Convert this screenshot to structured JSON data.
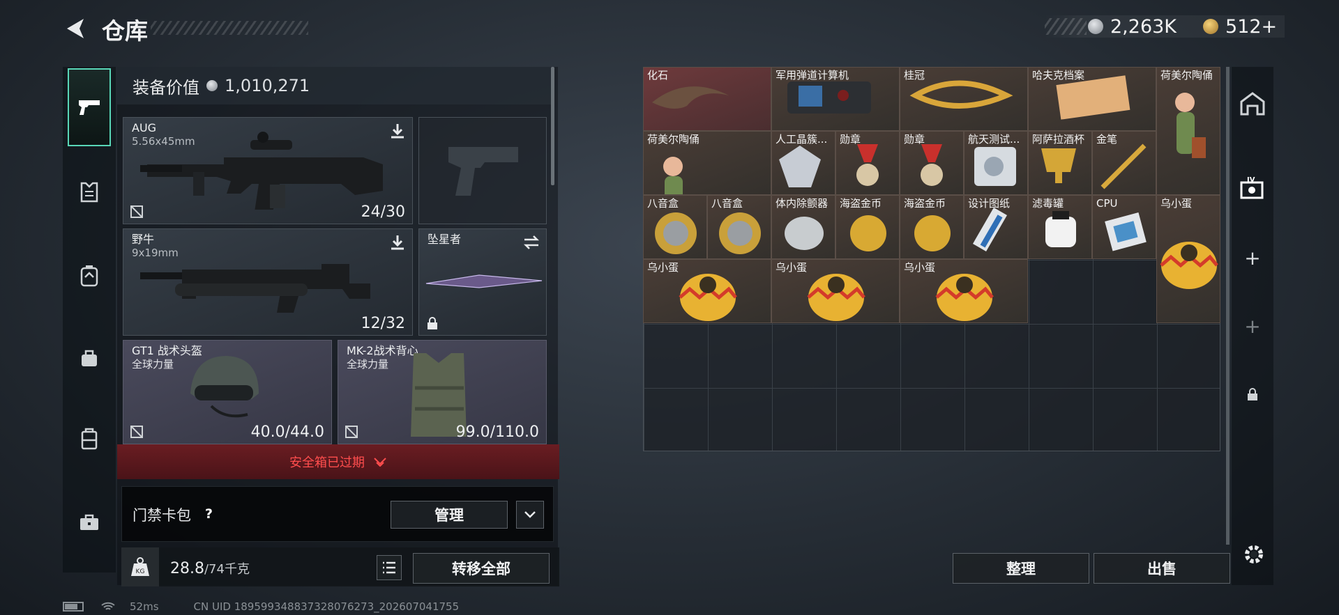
{
  "header": {
    "title": "仓库",
    "silver": "2,263K",
    "gold": "512+"
  },
  "equip_value": {
    "label": "装备价值",
    "value": "1,010,271"
  },
  "slots": {
    "primary": {
      "name": "AUG",
      "caliber": "5.56x45mm",
      "ammo": "24/30"
    },
    "secondary": {
      "name": "野牛",
      "caliber": "9x19mm",
      "ammo": "12/32"
    },
    "melee": {
      "name": "坠星者"
    },
    "helmet": {
      "name": "GT1 战术头盔",
      "brand": "全球力量",
      "durability": "40.0/44.0"
    },
    "vest": {
      "name": "MK-2战术背心",
      "brand": "全球力量",
      "durability": "99.0/110.0"
    }
  },
  "safebox": {
    "expired": "安全箱已过期"
  },
  "keycard": {
    "label": "门禁卡包",
    "help": "?",
    "manage": "管理"
  },
  "weight": {
    "current": "28.8",
    "max": "/74千克",
    "transfer_all": "转移全部"
  },
  "inventory": {
    "items": [
      "化石",
      "军用弹道计算机",
      "桂冠",
      "哈夫克档案",
      "荷美尔陶俑",
      "荷美尔陶俑",
      "人工晶簇...",
      "勋章",
      "勋章",
      "航天测试...",
      "阿萨拉酒杯",
      "金笔",
      "八音盒",
      "八音盒",
      "体内除颤器",
      "海盗金币",
      "海盗金币",
      "设计图纸",
      "滤毒罐",
      "CPU",
      "乌小蛋",
      "乌小蛋",
      "乌小蛋",
      "乌小蛋"
    ],
    "sort": "整理",
    "sell": "出售"
  },
  "status": {
    "ping": "52ms",
    "uid": "CN UID 1895993488373280​76273_202607041755"
  }
}
